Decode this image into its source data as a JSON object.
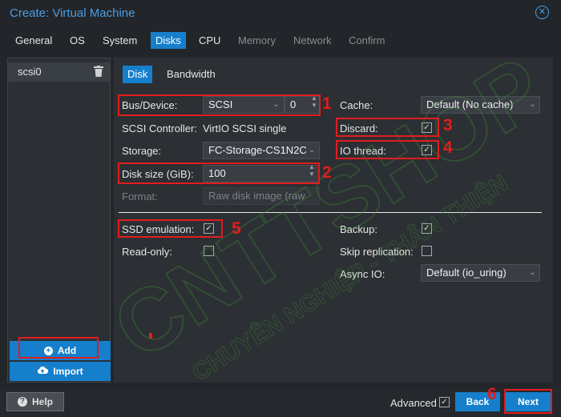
{
  "window": {
    "title": "Create: Virtual Machine"
  },
  "tabs": [
    {
      "label": "General"
    },
    {
      "label": "OS"
    },
    {
      "label": "System"
    },
    {
      "label": "Disks"
    },
    {
      "label": "CPU"
    },
    {
      "label": "Memory"
    },
    {
      "label": "Network"
    },
    {
      "label": "Confirm"
    }
  ],
  "disk_list": {
    "items": [
      "scsi0"
    ],
    "add_label": "Add",
    "import_label": "Import"
  },
  "subtabs": [
    "Disk",
    "Bandwidth"
  ],
  "form": {
    "bus_device": {
      "label": "Bus/Device:",
      "value": "SCSI",
      "index": "0"
    },
    "scsi_controller": {
      "label": "SCSI Controller:",
      "value": "VirtIO SCSI single"
    },
    "storage": {
      "label": "Storage:",
      "value": "FC-Storage-CS1N2C"
    },
    "disk_size": {
      "label": "Disk size (GiB):",
      "value": "100"
    },
    "format": {
      "label": "Format:",
      "value": "Raw disk image (raw"
    },
    "cache": {
      "label": "Cache:",
      "value": "Default (No cache)"
    },
    "discard": {
      "label": "Discard:",
      "checked": true
    },
    "io_thread": {
      "label": "IO thread:",
      "checked": true
    },
    "ssd_emulation": {
      "label": "SSD emulation:",
      "checked": true
    },
    "read_only": {
      "label": "Read-only:",
      "checked": false
    },
    "backup": {
      "label": "Backup:",
      "checked": true
    },
    "skip_replication": {
      "label": "Skip replication:",
      "checked": false
    },
    "async_io": {
      "label": "Async IO:",
      "value": "Default (io_uring)"
    }
  },
  "footer": {
    "help_label": "Help",
    "advanced_label": "Advanced",
    "advanced_checked": true,
    "back_label": "Back",
    "next_label": "Next"
  },
  "annotations": [
    "1",
    "2",
    "3",
    "4",
    "5",
    "6"
  ],
  "watermark": {
    "line1": "CNTTSHOP.VN",
    "line2": "CHUYÊN NGHIỆP - THÂN THIỆN"
  },
  "colors": {
    "accent": "#157fcc",
    "title": "#4a9ee3",
    "annotation": "#e11d1d",
    "background": "#222529"
  }
}
